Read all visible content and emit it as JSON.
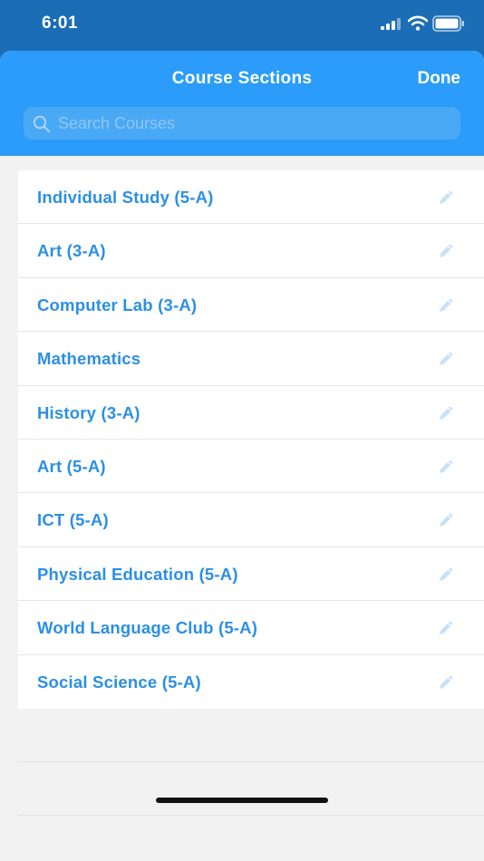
{
  "status_bar": {
    "time": "6:01",
    "icons": [
      "signal-icon",
      "wifi-icon",
      "battery-icon"
    ]
  },
  "nav": {
    "title": "Course Sections",
    "done_label": "Done"
  },
  "search": {
    "placeholder": "Search Courses",
    "value": ""
  },
  "courses": [
    {
      "label": "Individual Study (5-A)"
    },
    {
      "label": "Art (3-A)"
    },
    {
      "label": "Computer Lab (3-A)"
    },
    {
      "label": "Mathematics"
    },
    {
      "label": "History (3-A)"
    },
    {
      "label": "Art (5-A)"
    },
    {
      "label": "ICT (5-A)"
    },
    {
      "label": "Physical Education (5-A)"
    },
    {
      "label": "World Language Club (5-A)"
    },
    {
      "label": "Social Science (5-A)"
    }
  ],
  "colors": {
    "status_bar_bg": "#1b6eb5",
    "nav_bg": "#2b9cf9",
    "course_text": "#2b8fe6",
    "edit_icon": "#c7e1f7",
    "page_bg": "#f2f2f2"
  }
}
